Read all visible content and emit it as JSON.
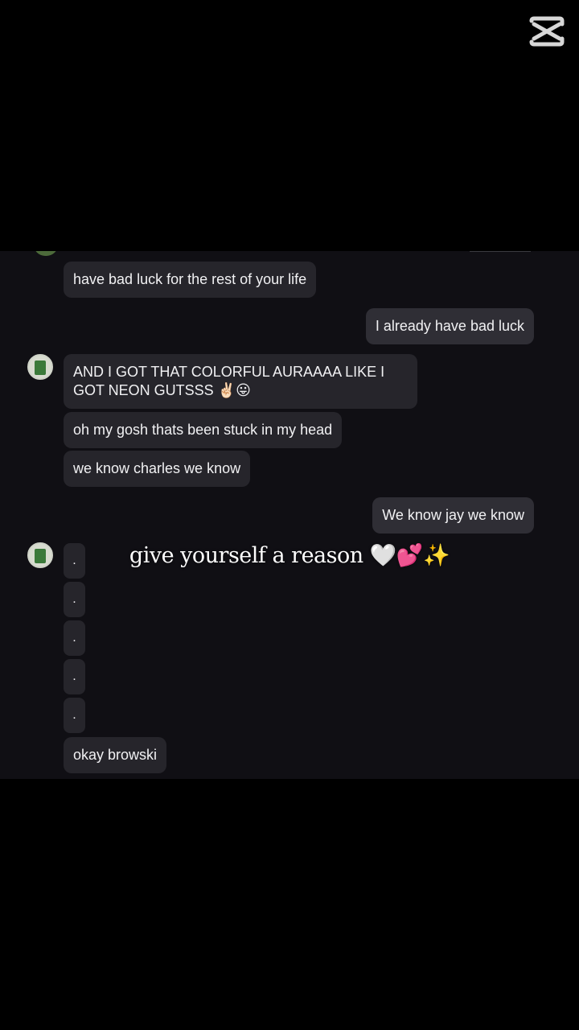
{
  "app_logo_icon": "capcut-logo-icon",
  "messages": [
    {
      "text": "have bad luck for the rest of your life"
    },
    {
      "text": "I already have bad luck"
    },
    {
      "text": "AND I GOT THAT COLORFUL AURAAAA LIKE I GOT NEON GUTSSS ✌🏻😛"
    },
    {
      "text": "oh my gosh thats been stuck in my head"
    },
    {
      "text": "we know charles we know"
    },
    {
      "text": "We know jay we know"
    },
    {
      "text": "."
    },
    {
      "text": "."
    },
    {
      "text": "."
    },
    {
      "text": "."
    },
    {
      "text": "."
    },
    {
      "text": "okay browski"
    }
  ],
  "caption": "give yourself a reason 🤍💕✨",
  "colors": {
    "background": "#000000",
    "chat_background": "#100f14",
    "incoming_bubble": "#26252b",
    "outgoing_bubble": "#2f2e35",
    "text": "#f1f1f3"
  }
}
